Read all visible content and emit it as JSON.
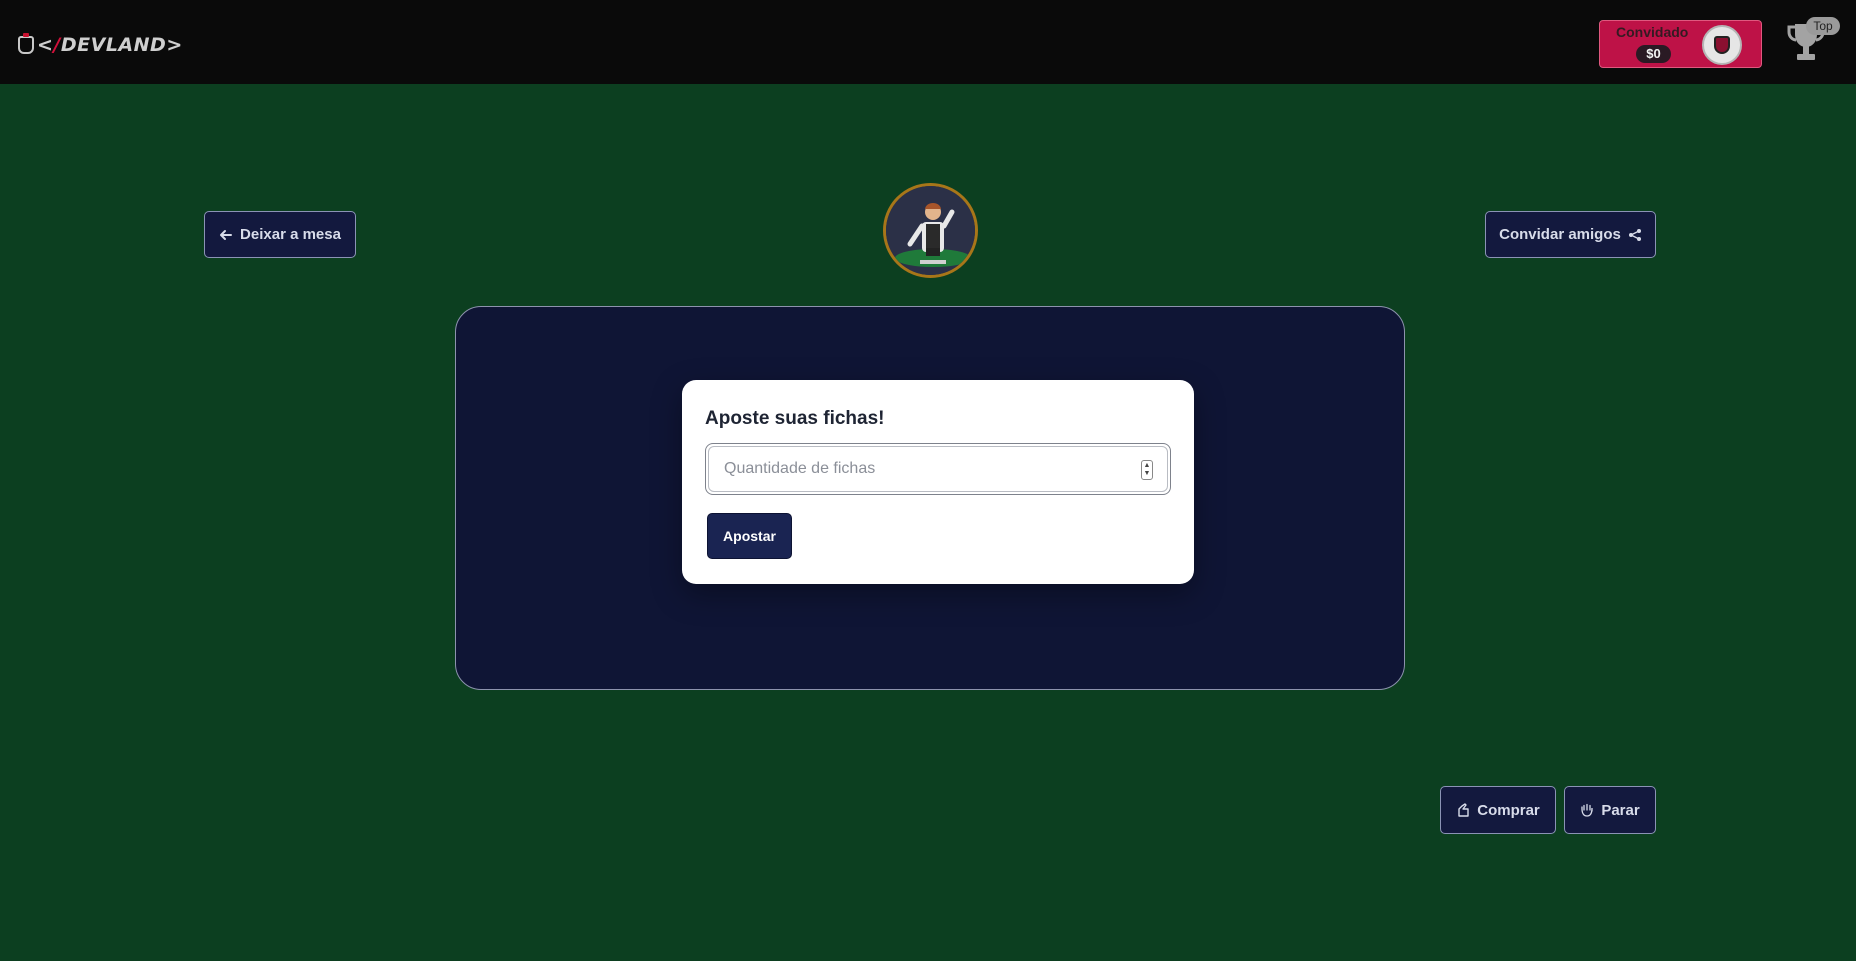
{
  "header": {
    "logo_text": "DEVLAND",
    "user": {
      "name": "Convidado",
      "balance": "$0"
    },
    "leaderboard_label": "Top"
  },
  "table_controls": {
    "leave_label": "Deixar a mesa",
    "invite_label": "Convidar amigos"
  },
  "bet": {
    "title": "Aposte suas fichas!",
    "placeholder": "Quantidade de fichas",
    "value": "",
    "submit_label": "Apostar"
  },
  "actions": {
    "buy_label": "Comprar",
    "stop_label": "Parar"
  },
  "colors": {
    "felt": "#0c3f20",
    "topbar": "#0a0a0a",
    "table": "#0f1535",
    "user_card": "#be1247",
    "button_dark": "#13193e",
    "dealer_ring": "#a87619"
  },
  "icons": {
    "leave": "arrow-left-icon",
    "invite": "share-icon",
    "buy": "hand-card-icon",
    "stop": "hand-stop-icon",
    "leaderboard": "trophy-icon"
  }
}
